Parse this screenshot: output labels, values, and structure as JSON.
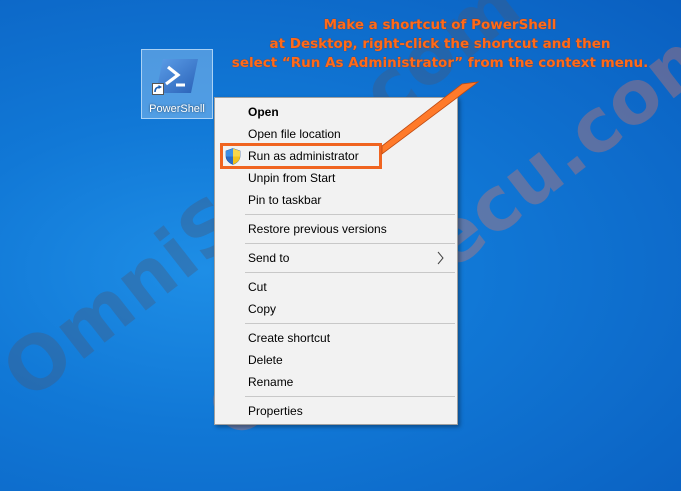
{
  "desktop": {
    "icon": {
      "label": "PowerShell",
      "icon": "powershell-icon"
    }
  },
  "annotation": {
    "lines": [
      "Make a shortcut of PowerShell",
      "at Desktop, right-click the shortcut and then",
      "select “Run As Administrator” from the context menu."
    ],
    "color": "#ff6a1a"
  },
  "watermark": {
    "text": "OmniSecu.com"
  },
  "context_menu": {
    "items": [
      {
        "label": "Open"
      },
      {
        "label": "Open file location"
      },
      {
        "label": "Run as administrator",
        "icon": "shield-icon"
      },
      {
        "label": "Unpin from Start"
      },
      {
        "label": "Pin to taskbar"
      },
      {
        "label": "Restore previous versions"
      },
      {
        "label": "Send to",
        "icon": "chevron-right-icon"
      },
      {
        "label": "Cut"
      },
      {
        "label": "Copy"
      },
      {
        "label": "Create shortcut"
      },
      {
        "label": "Delete"
      },
      {
        "label": "Rename"
      },
      {
        "label": "Properties"
      }
    ]
  },
  "colors": {
    "highlight": "#f06420",
    "desktop_bg": "#1178d6"
  }
}
